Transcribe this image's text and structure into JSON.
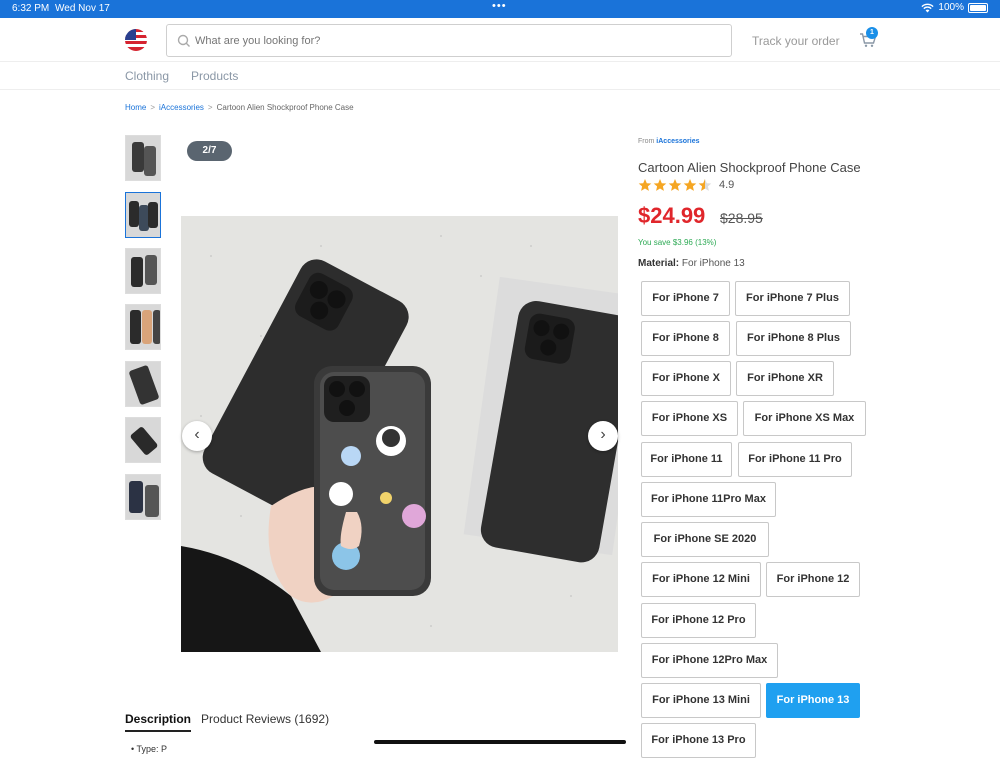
{
  "status_bar": {
    "time": "6:32 PM",
    "date": "Wed Nov 17",
    "dots": "•••",
    "battery": "100%"
  },
  "header": {
    "search_placeholder": "What are you looking for?",
    "track_order": "Track your order",
    "cart_count": "1"
  },
  "nav": {
    "items": [
      "Clothing",
      "Products"
    ]
  },
  "breadcrumb": {
    "home": "Home",
    "category": "iAccessories",
    "current": "Cartoon Alien Shockproof Phone Case",
    "sep": ">"
  },
  "gallery": {
    "counter": "2/7",
    "prev_icon": "chevron-left-icon",
    "next_icon": "chevron-right-icon",
    "active_thumb": 2
  },
  "product": {
    "from_label": "From",
    "vendor": "iAccessories",
    "title": "Cartoon Alien Shockproof Phone Case",
    "rating": "4.9",
    "price": "$24.99",
    "old_price": "$28.95",
    "savings": "You save $3.96 (13%)",
    "material_label": "Material:",
    "material_value": "For iPhone 13"
  },
  "options": [
    "For iPhone 7",
    "For iPhone 7 Plus",
    "For iPhone 8",
    "For iPhone 8 Plus",
    "For iPhone X",
    "For iPhone XR",
    "For iPhone XS",
    "For iPhone XS Max",
    "For iPhone 11",
    "For iPhone 11 Pro",
    "For iPhone 11Pro Max",
    "For iPhone SE 2020",
    "For iPhone 12 Mini",
    "For iPhone 12",
    "For iPhone 12 Pro",
    "For iPhone 12Pro Max",
    "For iPhone 13 Mini",
    "For iPhone 13",
    "For iPhone 13 Pro"
  ],
  "selected_option": "For iPhone 13",
  "tabs": {
    "description": "Description",
    "reviews": "Product Reviews (1692)"
  },
  "description_stub": "•   Type: P",
  "colors": {
    "accent": "#1a73d9",
    "price": "#e0262b",
    "save": "#2eaa55",
    "selected": "#1fa0f0"
  }
}
